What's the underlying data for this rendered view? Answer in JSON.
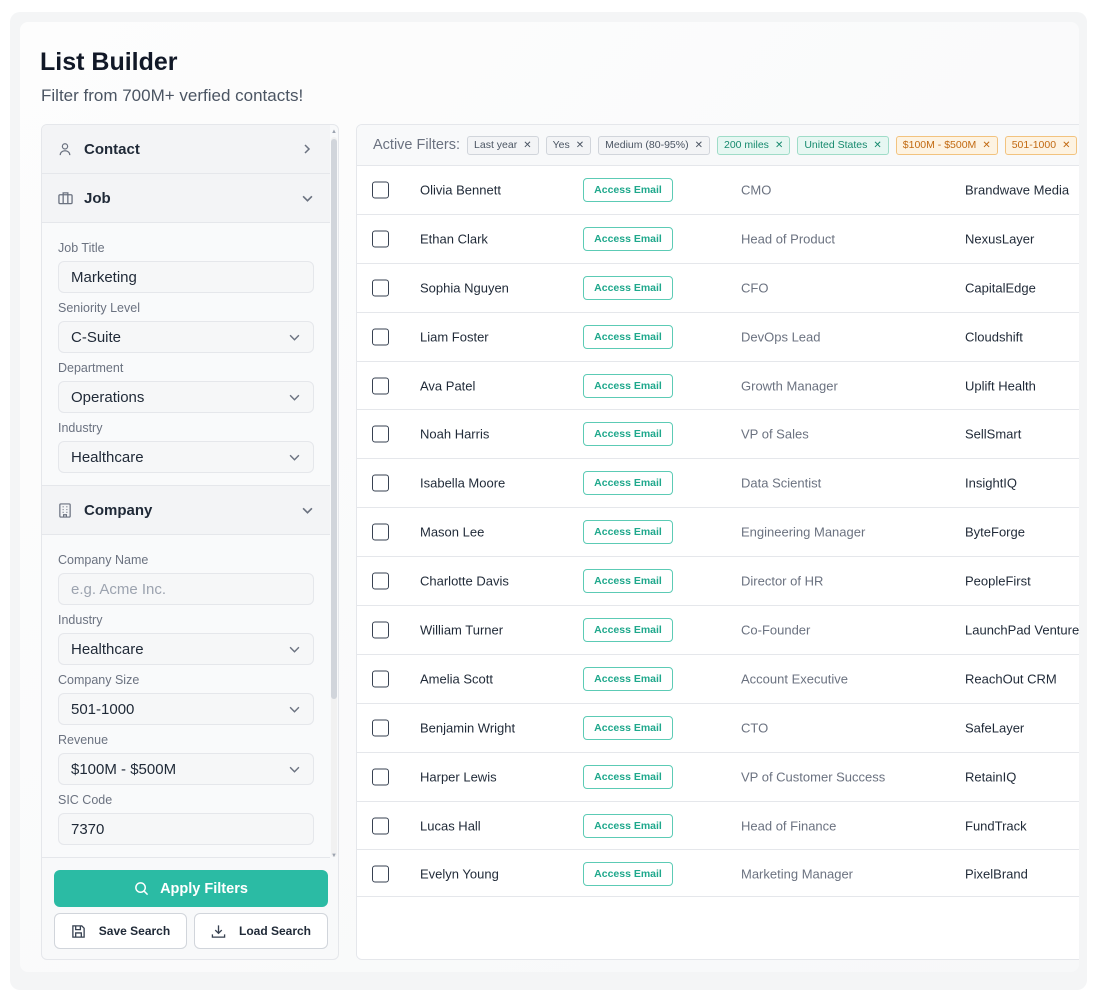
{
  "header": {
    "title": "List Builder",
    "subtitle": "Filter from 700M+ verfied contacts!"
  },
  "sidebar": {
    "sections": {
      "contact": {
        "label": "Contact",
        "icon": "user-icon",
        "expanded": false
      },
      "job": {
        "label": "Job",
        "icon": "briefcase-icon",
        "expanded": true,
        "fields": {
          "job_title": {
            "label": "Job Title",
            "value": "Marketing"
          },
          "seniority": {
            "label": "Seniority Level",
            "value": "C-Suite"
          },
          "department": {
            "label": "Department",
            "value": "Operations"
          },
          "industry": {
            "label": "Industry",
            "value": "Healthcare"
          }
        }
      },
      "company": {
        "label": "Company",
        "icon": "building-icon",
        "expanded": true,
        "fields": {
          "company_name": {
            "label": "Company Name",
            "placeholder": "e.g. Acme Inc."
          },
          "industry": {
            "label": "Industry",
            "value": "Healthcare"
          },
          "size": {
            "label": "Company Size",
            "value": "501-1000"
          },
          "revenue": {
            "label": "Revenue",
            "value": "$100M - $500M"
          },
          "sic": {
            "label": "SIC Code",
            "value": "7370"
          }
        }
      }
    },
    "buttons": {
      "apply": "Apply Filters",
      "save": "Save Search",
      "load": "Load Search"
    }
  },
  "filters": {
    "label": "Active Filters:",
    "chips": [
      {
        "text": "Last year",
        "style": "gray"
      },
      {
        "text": "Yes",
        "style": "gray"
      },
      {
        "text": "Medium (80-95%)",
        "style": "gray"
      },
      {
        "text": "200 miles",
        "style": "green"
      },
      {
        "text": "United States",
        "style": "green"
      },
      {
        "text": "$100M - $500M",
        "style": "orange"
      },
      {
        "text": "501-1000",
        "style": "orange"
      }
    ]
  },
  "table": {
    "access_label": "Access Email",
    "rows": [
      {
        "name": "Olivia Bennett",
        "role": "CMO",
        "company": "Brandwave Media"
      },
      {
        "name": "Ethan Clark",
        "role": "Head of Product",
        "company": "NexusLayer"
      },
      {
        "name": "Sophia Nguyen",
        "role": "CFO",
        "company": "CapitalEdge"
      },
      {
        "name": "Liam Foster",
        "role": "DevOps Lead",
        "company": "Cloudshift"
      },
      {
        "name": "Ava Patel",
        "role": "Growth Manager",
        "company": "Uplift Health"
      },
      {
        "name": "Noah Harris",
        "role": "VP of Sales",
        "company": "SellSmart"
      },
      {
        "name": "Isabella Moore",
        "role": "Data Scientist",
        "company": "InsightIQ"
      },
      {
        "name": "Mason Lee",
        "role": "Engineering Manager",
        "company": "ByteForge"
      },
      {
        "name": "Charlotte Davis",
        "role": "Director of HR",
        "company": "PeopleFirst"
      },
      {
        "name": "William Turner",
        "role": "Co-Founder",
        "company": "LaunchPad Ventures"
      },
      {
        "name": "Amelia Scott",
        "role": "Account Executive",
        "company": "ReachOut CRM"
      },
      {
        "name": "Benjamin Wright",
        "role": "CTO",
        "company": "SafeLayer"
      },
      {
        "name": "Harper Lewis",
        "role": "VP of Customer Success",
        "company": "RetainIQ"
      },
      {
        "name": "Lucas Hall",
        "role": "Head of Finance",
        "company": "FundTrack"
      },
      {
        "name": "Evelyn Young",
        "role": "Marketing Manager",
        "company": "PixelBrand"
      }
    ]
  },
  "colors": {
    "accent": "#2bbba4",
    "chip_green": "#168a6e",
    "chip_orange": "#c26a12"
  }
}
